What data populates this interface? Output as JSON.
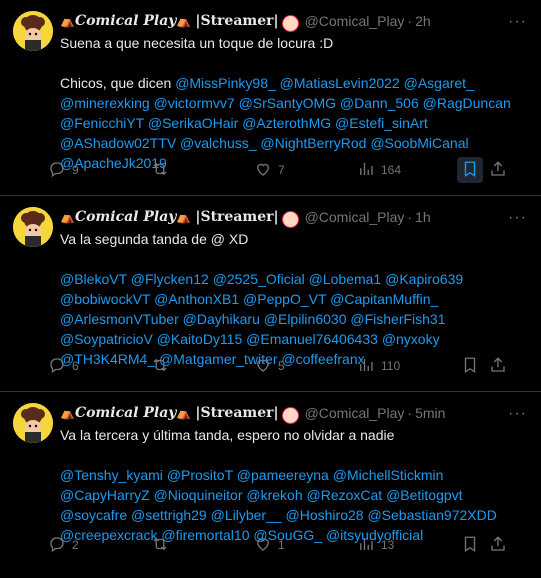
{
  "tweets": [
    {
      "name": "Comical Play",
      "stream": "|Streamer|",
      "handle": "@Comical_Play",
      "time": "2h",
      "line1": "Suena a que necesita un toque de locura :D",
      "line2": "Chicos, que dicen",
      "mentions": [
        "@MissPinky98_",
        "@MatiasLevin2022",
        "@Asgaret_",
        "@minerexking",
        "@victormvv7",
        "@SrSantyOMG",
        "@Dann_506",
        "@RagDuncan",
        "@FenicchiYT",
        "@SerikaOHair",
        "@AzterothMG",
        "@Estefi_sinArt",
        "@AShadow02TTV",
        "@valchuss_",
        "@NightBerryRod",
        "@SoobMiCanal",
        "@ApacheJk2019"
      ],
      "replies": "9",
      "retweets": "",
      "likes": "7",
      "views": "164",
      "bookmark_highlight": true
    },
    {
      "name": "Comical Play",
      "stream": "|Streamer|",
      "handle": "@Comical_Play",
      "time": "1h",
      "line1": "Va la segunda tanda de @ XD",
      "mentions": [
        "@BlekoVT",
        "@Flycken12",
        "@2525_Oficial",
        "@Lobema1",
        "@Kapiro639",
        "@bobiwockVT",
        "@AnthonXB1",
        "@PeppO_VT",
        "@CapitanMuffin_",
        "@ArlesmonVTuber",
        "@Dayhikaru",
        "@Elpilin6030",
        "@FisherFish31",
        "@SoypatricioV",
        "@KaitoDy115",
        "@Emanuel76406433",
        "@nyxoky",
        "@TH3K4RM4_",
        "@Matgamer_twiter",
        "@coffeefranx"
      ],
      "replies": "6",
      "retweets": "",
      "likes": "5",
      "views": "110",
      "bookmark_highlight": false
    },
    {
      "name": "Comical Play",
      "stream": "|Streamer|",
      "handle": "@Comical_Play",
      "time": "5min",
      "line1": "Va la tercera y última tanda, espero no olvidar a nadie",
      "mentions": [
        "@Tenshy_kyami",
        "@PrositoT",
        "@pameereyna",
        "@MichellStickmin",
        "@CapyHarryZ",
        "@Nioquineitor",
        "@krekoh",
        "@RezoxCat",
        "@Betitogpvt",
        "@soycafre",
        "@settrigh29",
        "@Lilyber__",
        "@Hoshiro28",
        "@Sebastian972XDD",
        "@creepexcrack",
        "@firemortal10",
        "@SouGG_",
        "@itsyudyofficial"
      ],
      "replies": "2",
      "retweets": "",
      "likes": "1",
      "views": "13",
      "bookmark_highlight": false
    }
  ],
  "separator": "·",
  "colors": {
    "link": "#1d9bf0",
    "muted": "#71767b",
    "text": "#e7e9ea",
    "tent": "#e0245e"
  },
  "icons": [
    "reply-icon",
    "retweet-icon",
    "like-icon",
    "views-icon",
    "bookmark-icon",
    "share-icon",
    "more-icon",
    "circus-tent-icon",
    "clown-icon"
  ]
}
